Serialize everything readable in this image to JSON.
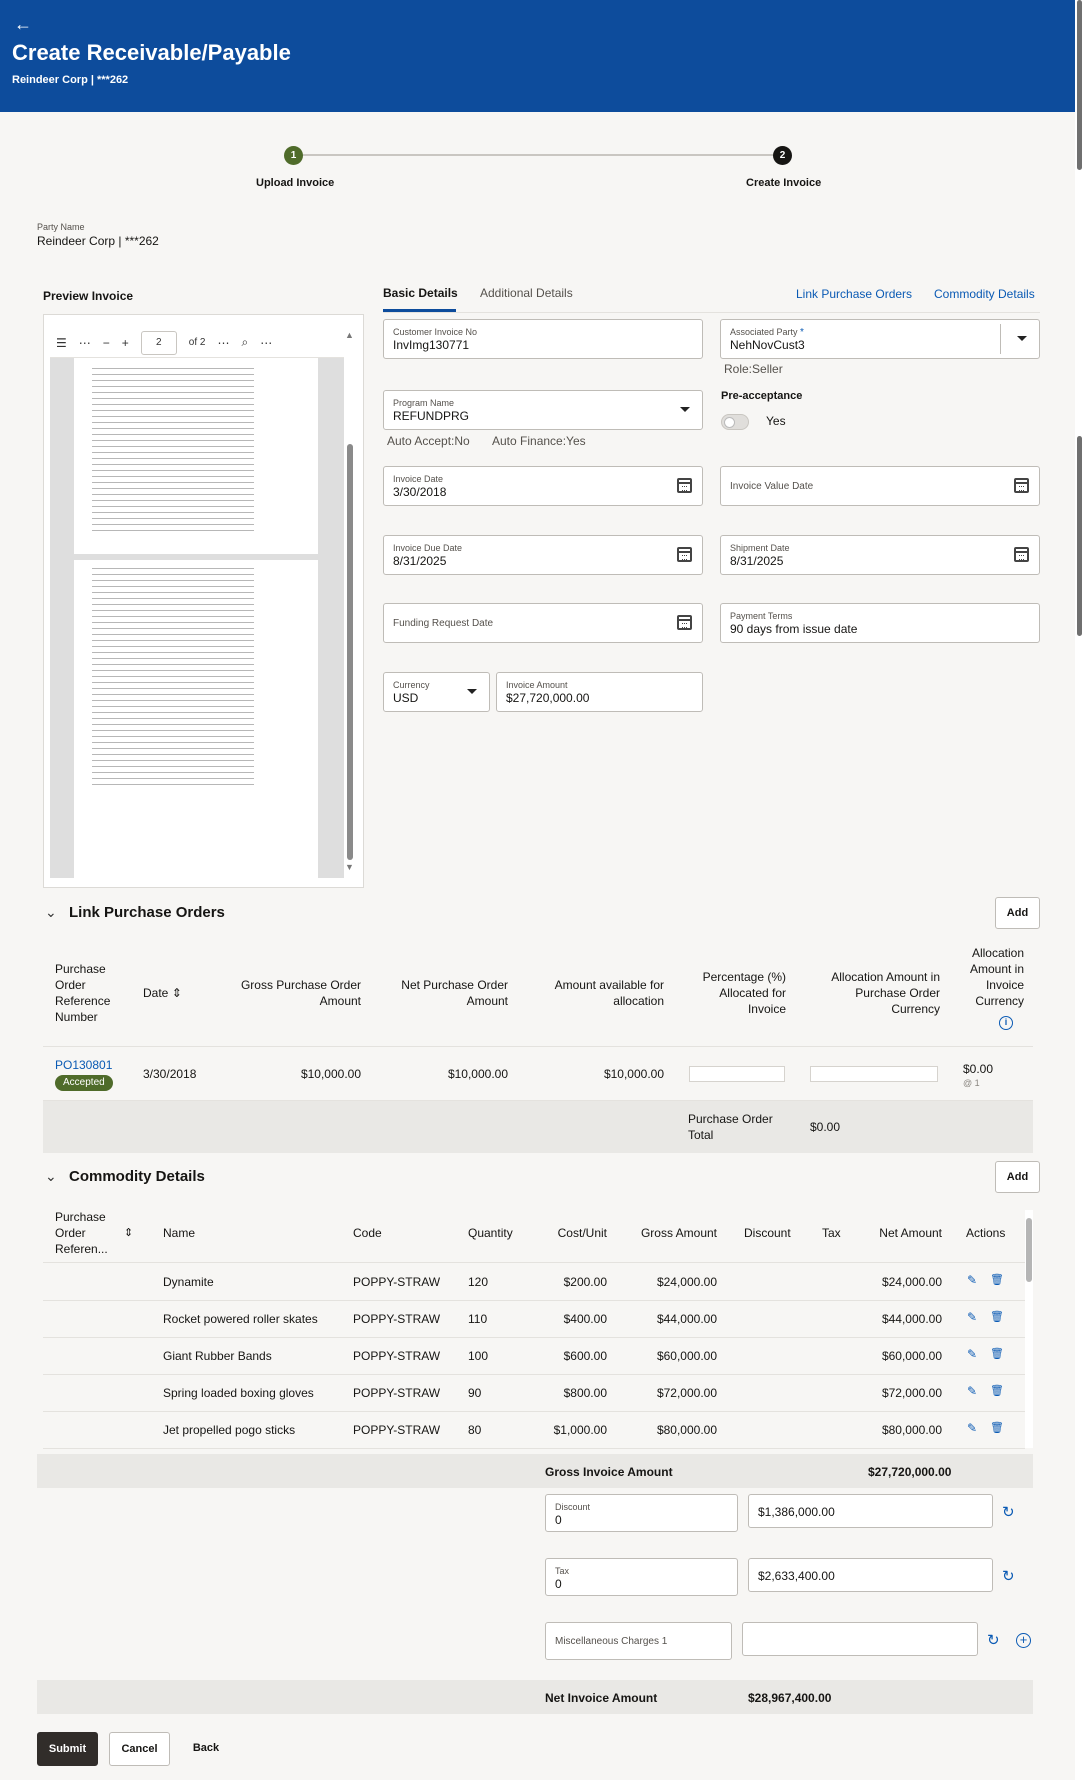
{
  "header": {
    "back_icon": "←",
    "title": "Create Receivable/Payable",
    "subtitle": "Reindeer Corp | ***262"
  },
  "stepper": [
    {
      "number": "1",
      "label": "Upload Invoice",
      "status": "complete"
    },
    {
      "number": "2",
      "label": "Create Invoice",
      "status": "current"
    }
  ],
  "party": {
    "label": "Party Name",
    "value": "Reindeer Corp | ***262"
  },
  "preview": {
    "label": "Preview Invoice",
    "page": "2",
    "of_pages": "of 2"
  },
  "tabs": {
    "basic": "Basic Details",
    "additional": "Additional Details"
  },
  "links": {
    "po": "Link Purchase Orders",
    "commodity": "Commodity Details"
  },
  "form": {
    "customer_invoice_no": {
      "label": "Customer Invoice No",
      "value": "InvImg130771"
    },
    "associated_party": {
      "label": "Associated Party",
      "required": "*",
      "value": "NehNovCust3",
      "role": "Role:Seller"
    },
    "program_name": {
      "label": "Program Name",
      "value": "REFUNDPRG",
      "auto_accept": "Auto Accept:No",
      "auto_finance": "Auto Finance:Yes"
    },
    "pre_acceptance": {
      "label": "Pre-acceptance",
      "value": "Yes"
    },
    "invoice_date": {
      "label": "Invoice Date",
      "value": "3/30/2018"
    },
    "invoice_value_date": {
      "label": "Invoice Value Date"
    },
    "invoice_due_date": {
      "label": "Invoice Due Date",
      "value": "8/31/2025"
    },
    "shipment_date": {
      "label": "Shipment Date",
      "value": "8/31/2025"
    },
    "funding_request_date": {
      "label": "Funding Request Date"
    },
    "payment_terms": {
      "label": "Payment Terms",
      "value": "90 days from issue date"
    },
    "currency": {
      "label": "Currency",
      "value": "USD"
    },
    "invoice_amount": {
      "label": "Invoice Amount",
      "value": "$27,720,000.00"
    }
  },
  "po_section": {
    "title": "Link Purchase Orders",
    "add_label": "Add",
    "columns": {
      "ref": "Purchase Order Reference Number",
      "date": "Date",
      "gross": "Gross Purchase Order Amount",
      "net": "Net Purchase Order Amount",
      "available": "Amount available for allocation",
      "pct": "Percentage (%) Allocated for Invoice",
      "alloc_po": "Allocation Amount in Purchase Order Currency",
      "alloc_inv": "Allocation Amount in Invoice Currency"
    },
    "rows": [
      {
        "ref": "PO130801",
        "status": "Accepted",
        "date": "3/30/2018",
        "gross": "$10,000.00",
        "net": "$10,000.00",
        "available": "$10,000.00",
        "alloc_inv": "$0.00",
        "rate": "@ 1"
      }
    ],
    "total_label": "Purchase Order Total",
    "total_value": "$0.00"
  },
  "commodity_section": {
    "title": "Commodity Details",
    "add_label": "Add",
    "columns": {
      "ref": "Purchase Order Referen...",
      "name": "Name",
      "code": "Code",
      "qty": "Quantity",
      "cost": "Cost/Unit",
      "gross": "Gross Amount",
      "discount": "Discount",
      "tax": "Tax",
      "net": "Net Amount",
      "actions": "Actions"
    },
    "rows": [
      {
        "name": "Dynamite",
        "code": "POPPY-STRAW",
        "qty": "120",
        "cost": "$200.00",
        "gross": "$24,000.00",
        "net": "$24,000.00"
      },
      {
        "name": "Rocket powered roller skates",
        "code": "POPPY-STRAW",
        "qty": "110",
        "cost": "$400.00",
        "gross": "$44,000.00",
        "net": "$44,000.00"
      },
      {
        "name": "Giant Rubber Bands",
        "code": "POPPY-STRAW",
        "qty": "100",
        "cost": "$600.00",
        "gross": "$60,000.00",
        "net": "$60,000.00"
      },
      {
        "name": "Spring loaded boxing gloves",
        "code": "POPPY-STRAW",
        "qty": "90",
        "cost": "$800.00",
        "gross": "$72,000.00",
        "net": "$72,000.00"
      },
      {
        "name": "Jet propelled pogo sticks",
        "code": "POPPY-STRAW",
        "qty": "80",
        "cost": "$1,000.00",
        "gross": "$80,000.00",
        "net": "$80,000.00"
      }
    ]
  },
  "totals": {
    "gross_label": "Gross Invoice Amount",
    "gross_value": "$27,720,000.00",
    "discount": {
      "label": "Discount",
      "value": "0",
      "amount": "$1,386,000.00"
    },
    "tax": {
      "label": "Tax",
      "value": "0",
      "amount": "$2,633,400.00"
    },
    "misc": {
      "label": "Miscellaneous Charges 1",
      "amount": ""
    },
    "net_label": "Net Invoice Amount",
    "net_value": "$28,967,400.00"
  },
  "buttons": {
    "submit": "Submit",
    "cancel": "Cancel",
    "back": "Back"
  },
  "colors": {
    "header_bg": "#0d4c9c",
    "link": "#0a5ab4",
    "accepted_badge": "#4f6b2a",
    "primary_button": "#312d2a"
  }
}
